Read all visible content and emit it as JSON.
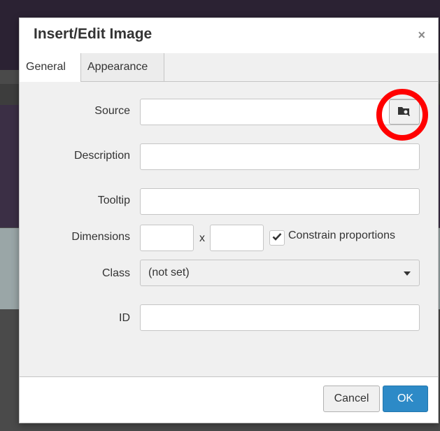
{
  "dialog": {
    "title": "Insert/Edit Image",
    "close_glyph": "×"
  },
  "tabs": [
    {
      "label": "General",
      "active": true
    },
    {
      "label": "Appearance",
      "active": false
    }
  ],
  "form": {
    "source": {
      "label": "Source",
      "value": ""
    },
    "description": {
      "label": "Description",
      "value": ""
    },
    "tooltip": {
      "label": "Tooltip",
      "value": ""
    },
    "dimensions": {
      "label": "Dimensions",
      "width": "",
      "height": "",
      "separator": "x"
    },
    "constrain": {
      "label": "Constrain proportions",
      "checked": true
    },
    "class": {
      "label": "Class",
      "selected": "(not set)"
    },
    "id": {
      "label": "ID",
      "value": ""
    }
  },
  "buttons": {
    "cancel": "Cancel",
    "ok": "OK"
  },
  "icons": {
    "browse": "folder-search-icon",
    "annotation": "red-circle-highlight"
  },
  "colors": {
    "primary": "#2d8ac7",
    "highlight": "#ff0000"
  }
}
